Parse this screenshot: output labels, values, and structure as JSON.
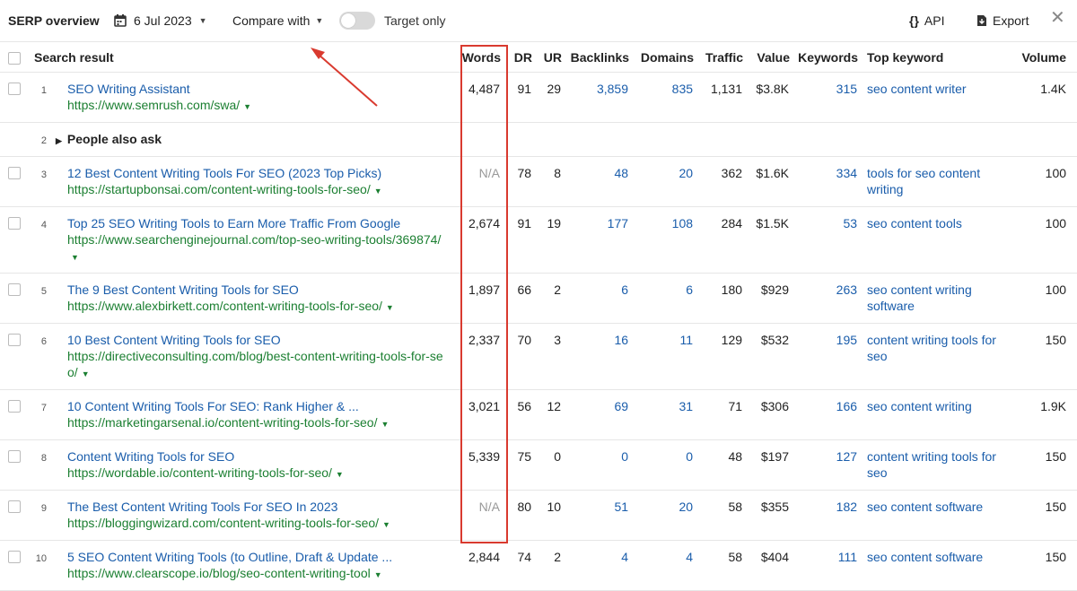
{
  "toolbar": {
    "title": "SERP overview",
    "date": "6 Jul 2023",
    "compare_label": "Compare with",
    "target_only_label": "Target only",
    "api_label": "API",
    "export_label": "Export",
    "icons": {
      "calendar": "calendar-icon",
      "api": "braces-icon",
      "export": "export-icon",
      "close": "close-icon"
    }
  },
  "columns": {
    "search_result": "Search result",
    "words": "Words",
    "dr": "DR",
    "ur": "UR",
    "backlinks": "Backlinks",
    "domains": "Domains",
    "traffic": "Traffic",
    "value": "Value",
    "keywords": "Keywords",
    "top_keyword": "Top keyword",
    "volume": "Volume"
  },
  "rows": [
    {
      "idx": "1",
      "title": "SEO Writing Assistant",
      "url": "https://www.semrush.com/swa/",
      "words": "4,487",
      "dr": "91",
      "ur": "29",
      "backlinks": "3,859",
      "domains": "835",
      "traffic": "1,131",
      "value": "$3.8K",
      "keywords": "315",
      "top_keyword": "seo content writer",
      "volume": "1.4K"
    },
    {
      "idx": "2",
      "paa": "People also ask"
    },
    {
      "idx": "3",
      "title": "12 Best Content Writing Tools For SEO (2023 Top Picks)",
      "url": "https://startupbonsai.com/content-writing-tools-for-seo/",
      "words": "N/A",
      "dr": "78",
      "ur": "8",
      "backlinks": "48",
      "domains": "20",
      "traffic": "362",
      "value": "$1.6K",
      "keywords": "334",
      "top_keyword": "tools for seo content writing",
      "volume": "100"
    },
    {
      "idx": "4",
      "title": "Top 25 SEO Writing Tools to Earn More Traffic From Google",
      "url": "https://www.searchenginejournal.com/top-seo-writing-tools/369874/",
      "words": "2,674",
      "dr": "91",
      "ur": "19",
      "backlinks": "177",
      "domains": "108",
      "traffic": "284",
      "value": "$1.5K",
      "keywords": "53",
      "top_keyword": "seo content tools",
      "volume": "100"
    },
    {
      "idx": "5",
      "title": "The 9 Best Content Writing Tools for SEO",
      "url": "https://www.alexbirkett.com/content-writing-tools-for-seo/",
      "words": "1,897",
      "dr": "66",
      "ur": "2",
      "backlinks": "6",
      "domains": "6",
      "traffic": "180",
      "value": "$929",
      "keywords": "263",
      "top_keyword": "seo content writing software",
      "volume": "100"
    },
    {
      "idx": "6",
      "title": "10 Best Content Writing Tools for SEO",
      "url": "https://directiveconsulting.com/blog/best-content-writing-tools-for-seo/",
      "words": "2,337",
      "dr": "70",
      "ur": "3",
      "backlinks": "16",
      "domains": "11",
      "traffic": "129",
      "value": "$532",
      "keywords": "195",
      "top_keyword": "content writing tools for seo",
      "volume": "150"
    },
    {
      "idx": "7",
      "title": "10 Content Writing Tools For SEO: Rank Higher & ...",
      "url": "https://marketingarsenal.io/content-writing-tools-for-seo/",
      "words": "3,021",
      "dr": "56",
      "ur": "12",
      "backlinks": "69",
      "domains": "31",
      "traffic": "71",
      "value": "$306",
      "keywords": "166",
      "top_keyword": "seo content writing",
      "volume": "1.9K"
    },
    {
      "idx": "8",
      "title": "Content Writing Tools for SEO",
      "url": "https://wordable.io/content-writing-tools-for-seo/",
      "words": "5,339",
      "dr": "75",
      "ur": "0",
      "backlinks": "0",
      "domains": "0",
      "traffic": "48",
      "value": "$197",
      "keywords": "127",
      "top_keyword": "content writing tools for seo",
      "volume": "150"
    },
    {
      "idx": "9",
      "title": "The Best Content Writing Tools For SEO In 2023",
      "url": "https://bloggingwizard.com/content-writing-tools-for-seo/",
      "words": "N/A",
      "dr": "80",
      "ur": "10",
      "backlinks": "51",
      "domains": "20",
      "traffic": "58",
      "value": "$355",
      "keywords": "182",
      "top_keyword": "seo content software",
      "volume": "150"
    },
    {
      "idx": "10",
      "title": "5 SEO Content Writing Tools (to Outline, Draft & Update ...",
      "url": "https://www.clearscope.io/blog/seo-content-writing-tool",
      "words": "2,844",
      "dr": "74",
      "ur": "2",
      "backlinks": "4",
      "domains": "4",
      "traffic": "58",
      "value": "$404",
      "keywords": "111",
      "top_keyword": "seo content software",
      "volume": "150"
    }
  ],
  "colors": {
    "link": "#1a5dab",
    "url": "#1b7f31",
    "highlight": "#d93a2f"
  }
}
